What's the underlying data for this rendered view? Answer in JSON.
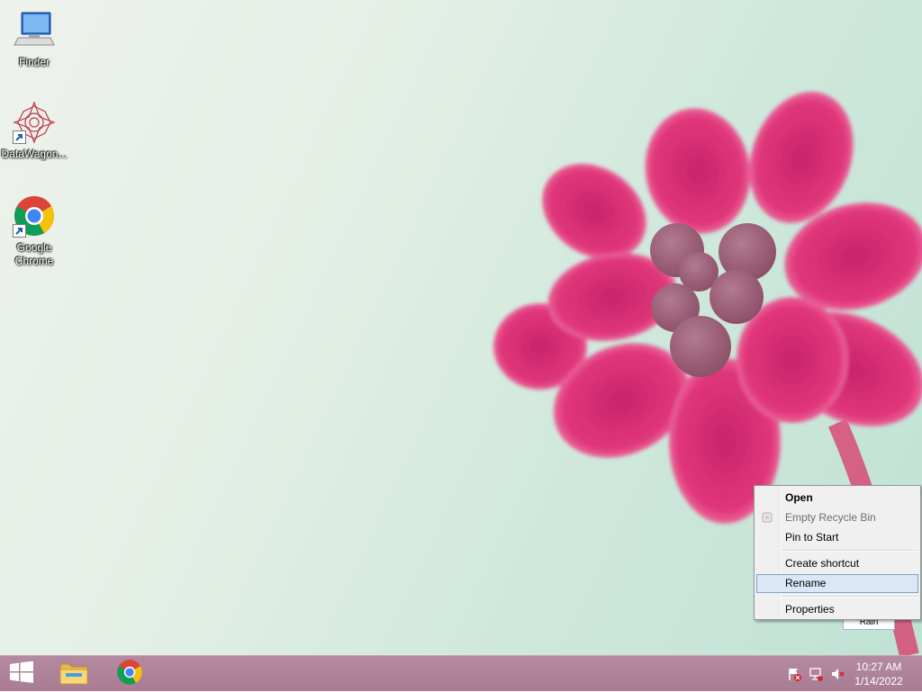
{
  "desktop": {
    "icons": [
      {
        "label": "Finder",
        "icon": "computer-icon"
      },
      {
        "label": "DataWagon...",
        "icon": "datawagon-icon"
      },
      {
        "label": "Google Chrome",
        "icon": "chrome-icon"
      }
    ],
    "selected_icon_partial_label": "Rain"
  },
  "context_menu": {
    "items": [
      {
        "label": "Open",
        "bold": true
      },
      {
        "label": "Empty Recycle Bin",
        "disabled": true
      },
      {
        "label": "Pin to Start"
      },
      {
        "label": "Create shortcut"
      },
      {
        "label": "Rename",
        "highlighted": true
      },
      {
        "label": "Properties"
      }
    ]
  },
  "taskbar": {
    "start_icon": "windows-logo-icon",
    "pinned": [
      {
        "name": "File Explorer",
        "icon": "folder-icon"
      },
      {
        "name": "Google Chrome",
        "icon": "chrome-icon"
      }
    ],
    "tray": [
      "action-center-flag-icon",
      "network-icon",
      "volume-muted-icon"
    ],
    "clock": {
      "time": "10:27 AM",
      "date": "1/14/2022"
    }
  },
  "colors": {
    "taskbar": "#a87d93",
    "menu_highlight": "#d9e7f6",
    "petal": "#e0367a"
  }
}
